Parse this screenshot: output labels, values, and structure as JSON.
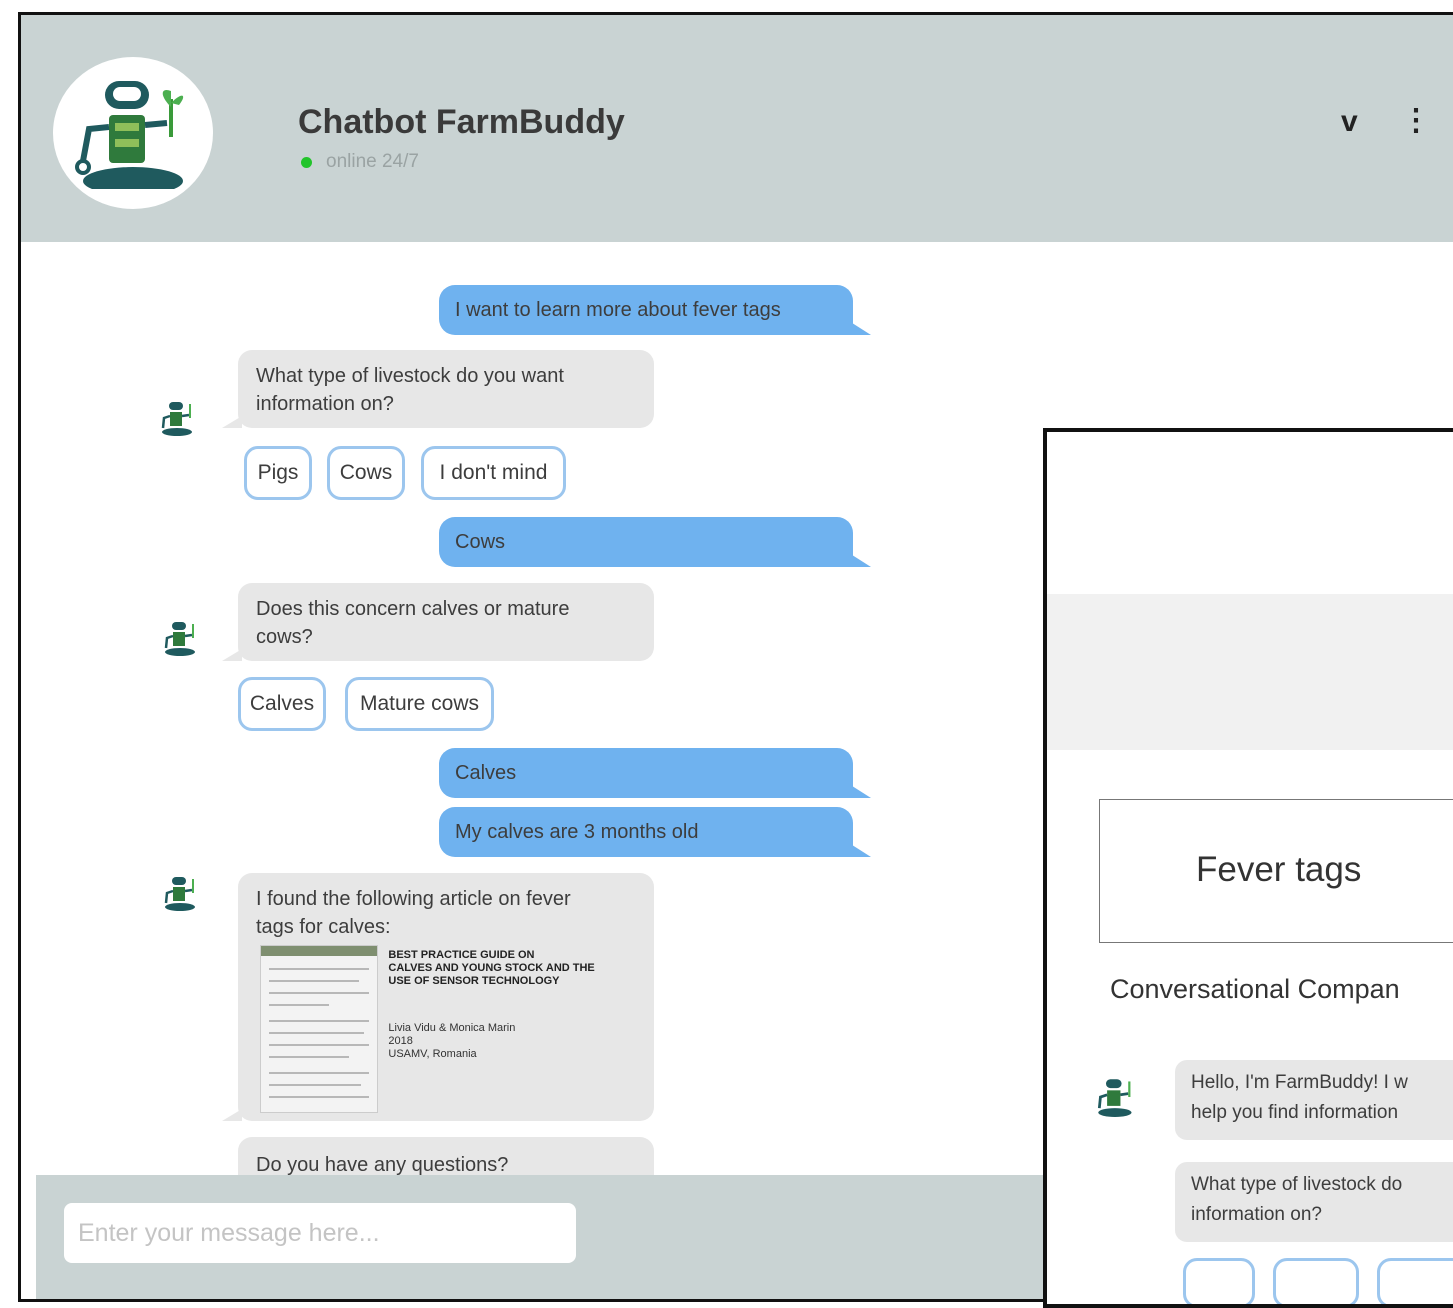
{
  "header": {
    "title": "Chatbot FarmBuddy",
    "status": "online 24/7",
    "chevron_glyph": "v",
    "menu_glyph": "⋮",
    "status_color": "#22c42b"
  },
  "conversation": {
    "user_msg_1": "I want to learn more about fever tags",
    "bot_msg_1_line1": "What type of livestock do you want",
    "bot_msg_1_line2": "information on?",
    "chips_1": [
      "Pigs",
      "Cows",
      "I don't mind"
    ],
    "user_msg_2": "Cows",
    "bot_msg_2_line1": "Does this concern calves or mature",
    "bot_msg_2_line2": "cows?",
    "chips_2": [
      "Calves",
      "Mature cows"
    ],
    "user_msg_3": "Calves",
    "user_msg_4": "My calves are 3 months old",
    "bot_msg_3_line1": "I found the following article on fever",
    "bot_msg_3_line2": "tags for calves:",
    "article": {
      "title_line1": "BEST PRACTICE GUIDE ON",
      "title_line2": "CALVES AND YOUNG STOCK AND THE",
      "title_line3": "USE OF SENSOR TECHNOLOGY",
      "authors": "Livia Vidu & Monica Marin",
      "year": "2018",
      "institution": "USAMV, Romania"
    },
    "bot_msg_4": "Do you have any questions?"
  },
  "composer": {
    "placeholder": "Enter your message here..."
  },
  "overlay": {
    "box_title": "Fever tags",
    "subtitle": "Conversational Compan",
    "bubble_1_line1": "Hello, I'm FarmBuddy! I w",
    "bubble_1_line2": "help you find information",
    "bubble_2_line1": "What type of livestock do",
    "bubble_2_line2": "information on?"
  },
  "colors": {
    "header_bg": "#c9d3d3",
    "user_bubble": "#6fb2ef",
    "bot_bubble": "#e7e7e7",
    "chip_border": "#9cc6ee",
    "robot_green": "#2f7a3c",
    "robot_dark": "#1f5a5e"
  }
}
